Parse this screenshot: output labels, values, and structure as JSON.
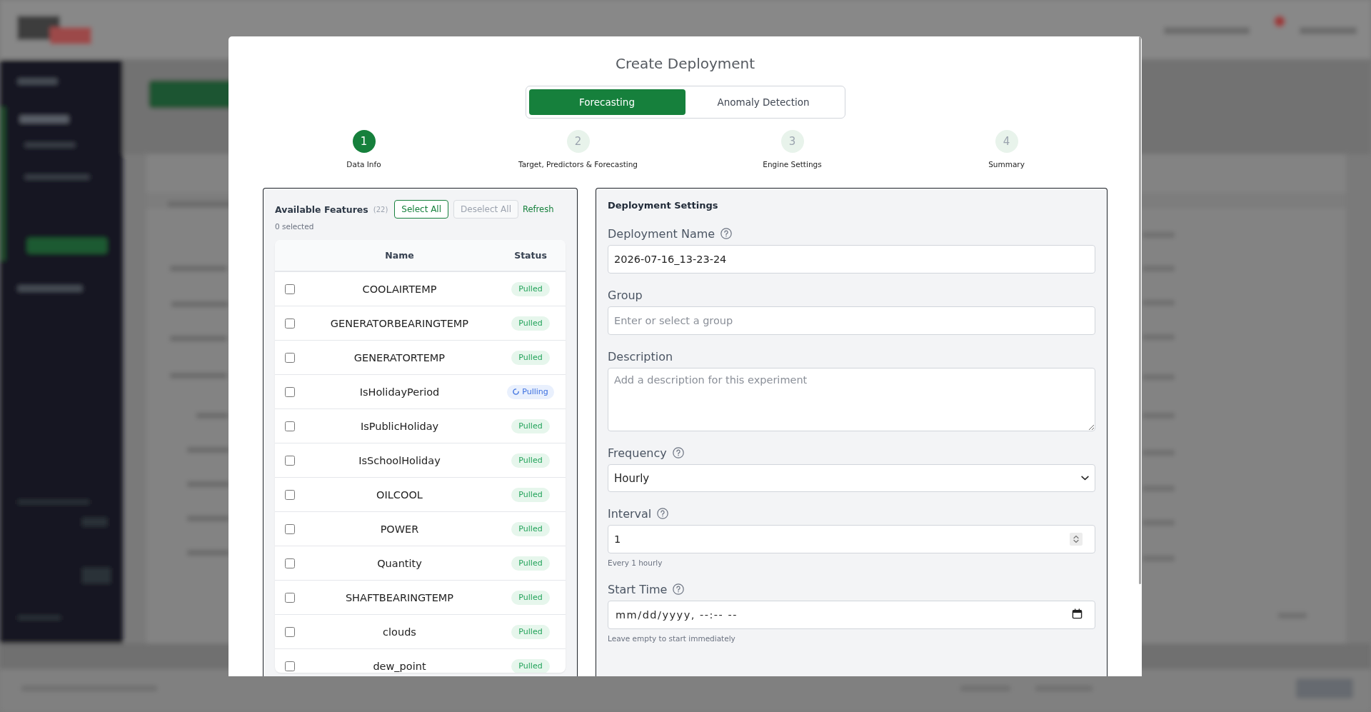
{
  "dialog": {
    "title": "Create Deployment",
    "mode_tabs": [
      {
        "label": "Forecasting",
        "selected": true
      },
      {
        "label": "Anomaly Detection",
        "selected": false
      }
    ],
    "steps": [
      {
        "number": "1",
        "label": "Data Info",
        "active": true
      },
      {
        "number": "2",
        "label": "Target, Predictors & Forecasting",
        "active": false
      },
      {
        "number": "3",
        "label": "Engine Settings",
        "active": false
      },
      {
        "number": "4",
        "label": "Summary",
        "active": false
      }
    ],
    "features": {
      "title": "Available Features",
      "count": "(22)",
      "buttons": [
        {
          "label": "Select All",
          "disabled": false
        },
        {
          "label": "Deselect All",
          "disabled": true
        }
      ],
      "refresh_link": "Refresh",
      "selection_note": "0 selected",
      "columns": [
        "Name",
        "Status"
      ],
      "rows": [
        {
          "name": "COOLAIRTEMP",
          "checked": false,
          "status": {
            "kind": "pulled",
            "label": "Pulled"
          }
        },
        {
          "name": "GENERATORBEARINGTEMP",
          "checked": false,
          "status": {
            "kind": "pulled",
            "label": "Pulled"
          }
        },
        {
          "name": "GENERATORTEMP",
          "checked": false,
          "status": {
            "kind": "pulled",
            "label": "Pulled"
          }
        },
        {
          "name": "IsHolidayPeriod",
          "checked": false,
          "status": {
            "kind": "pulling",
            "label": "Pulling"
          }
        },
        {
          "name": "IsPublicHoliday",
          "checked": false,
          "status": {
            "kind": "pulled",
            "label": "Pulled"
          }
        },
        {
          "name": "IsSchoolHoliday",
          "checked": false,
          "status": {
            "kind": "pulled",
            "label": "Pulled"
          }
        },
        {
          "name": "OILCOOL",
          "checked": false,
          "status": {
            "kind": "pulled",
            "label": "Pulled"
          }
        },
        {
          "name": "POWER",
          "checked": false,
          "status": {
            "kind": "pulled",
            "label": "Pulled"
          }
        },
        {
          "name": "Quantity",
          "checked": false,
          "status": {
            "kind": "pulled",
            "label": "Pulled"
          }
        },
        {
          "name": "SHAFTBEARINGTEMP",
          "checked": false,
          "status": {
            "kind": "pulled",
            "label": "Pulled"
          }
        },
        {
          "name": "clouds",
          "checked": false,
          "status": {
            "kind": "pulled",
            "label": "Pulled"
          }
        },
        {
          "name": "dew_point",
          "checked": false,
          "status": {
            "kind": "pulled",
            "label": "Pulled"
          }
        }
      ]
    },
    "settings": {
      "title": "Deployment Settings",
      "fields": [
        {
          "kind": "text",
          "label": "Deployment Name",
          "help": true,
          "value": "2026-07-16_13-23-24"
        },
        {
          "kind": "text",
          "label": "Group",
          "help": false,
          "placeholder": "Enter or select a group"
        },
        {
          "kind": "textarea",
          "label": "Description",
          "help": false,
          "placeholder": "Add a description for this experiment"
        },
        {
          "kind": "select",
          "label": "Frequency",
          "help": true,
          "value": "Hourly"
        },
        {
          "kind": "number",
          "label": "Interval",
          "help": true,
          "value": "1",
          "hint": "Every 1 hourly"
        },
        {
          "kind": "datetime",
          "label": "Start Time",
          "help": true,
          "placeholder": "mm/dd/yyyy, --:-- --",
          "hint": "Leave empty to start immediately"
        }
      ]
    }
  }
}
